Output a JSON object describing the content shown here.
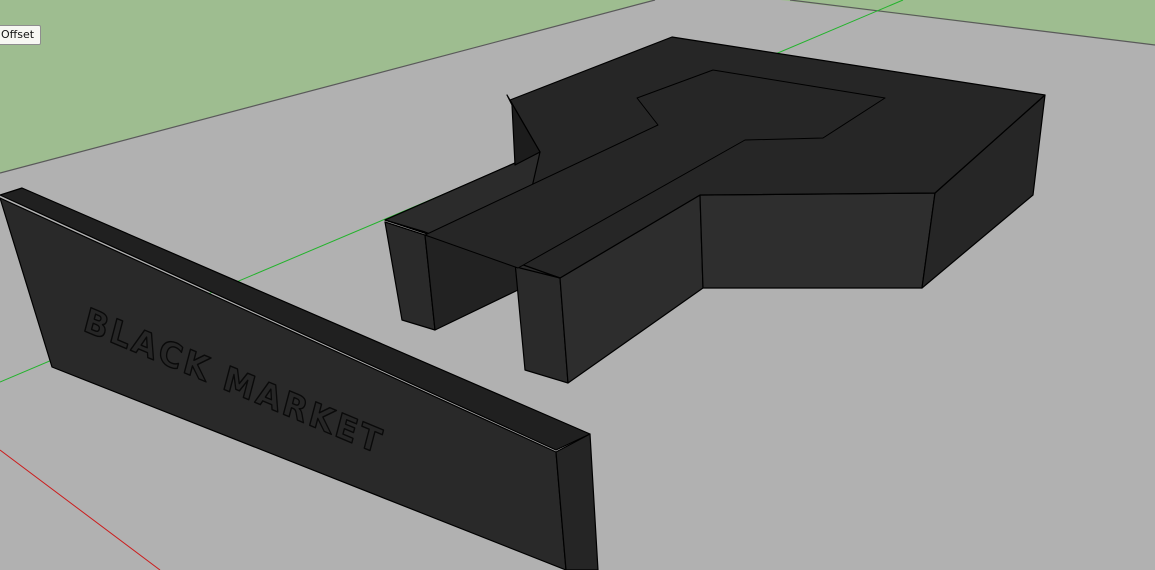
{
  "tooltip": {
    "label": "Offset"
  },
  "sign": {
    "text": "BLACK MARKET"
  },
  "colors": {
    "sky": "#9ebd90",
    "ground": "#b1b1b1",
    "model_top": "#262626",
    "model_side": "#2c2c2c",
    "edge": "#000000",
    "green_axis": "#22b32b",
    "red_axis": "#cc1d1d"
  }
}
